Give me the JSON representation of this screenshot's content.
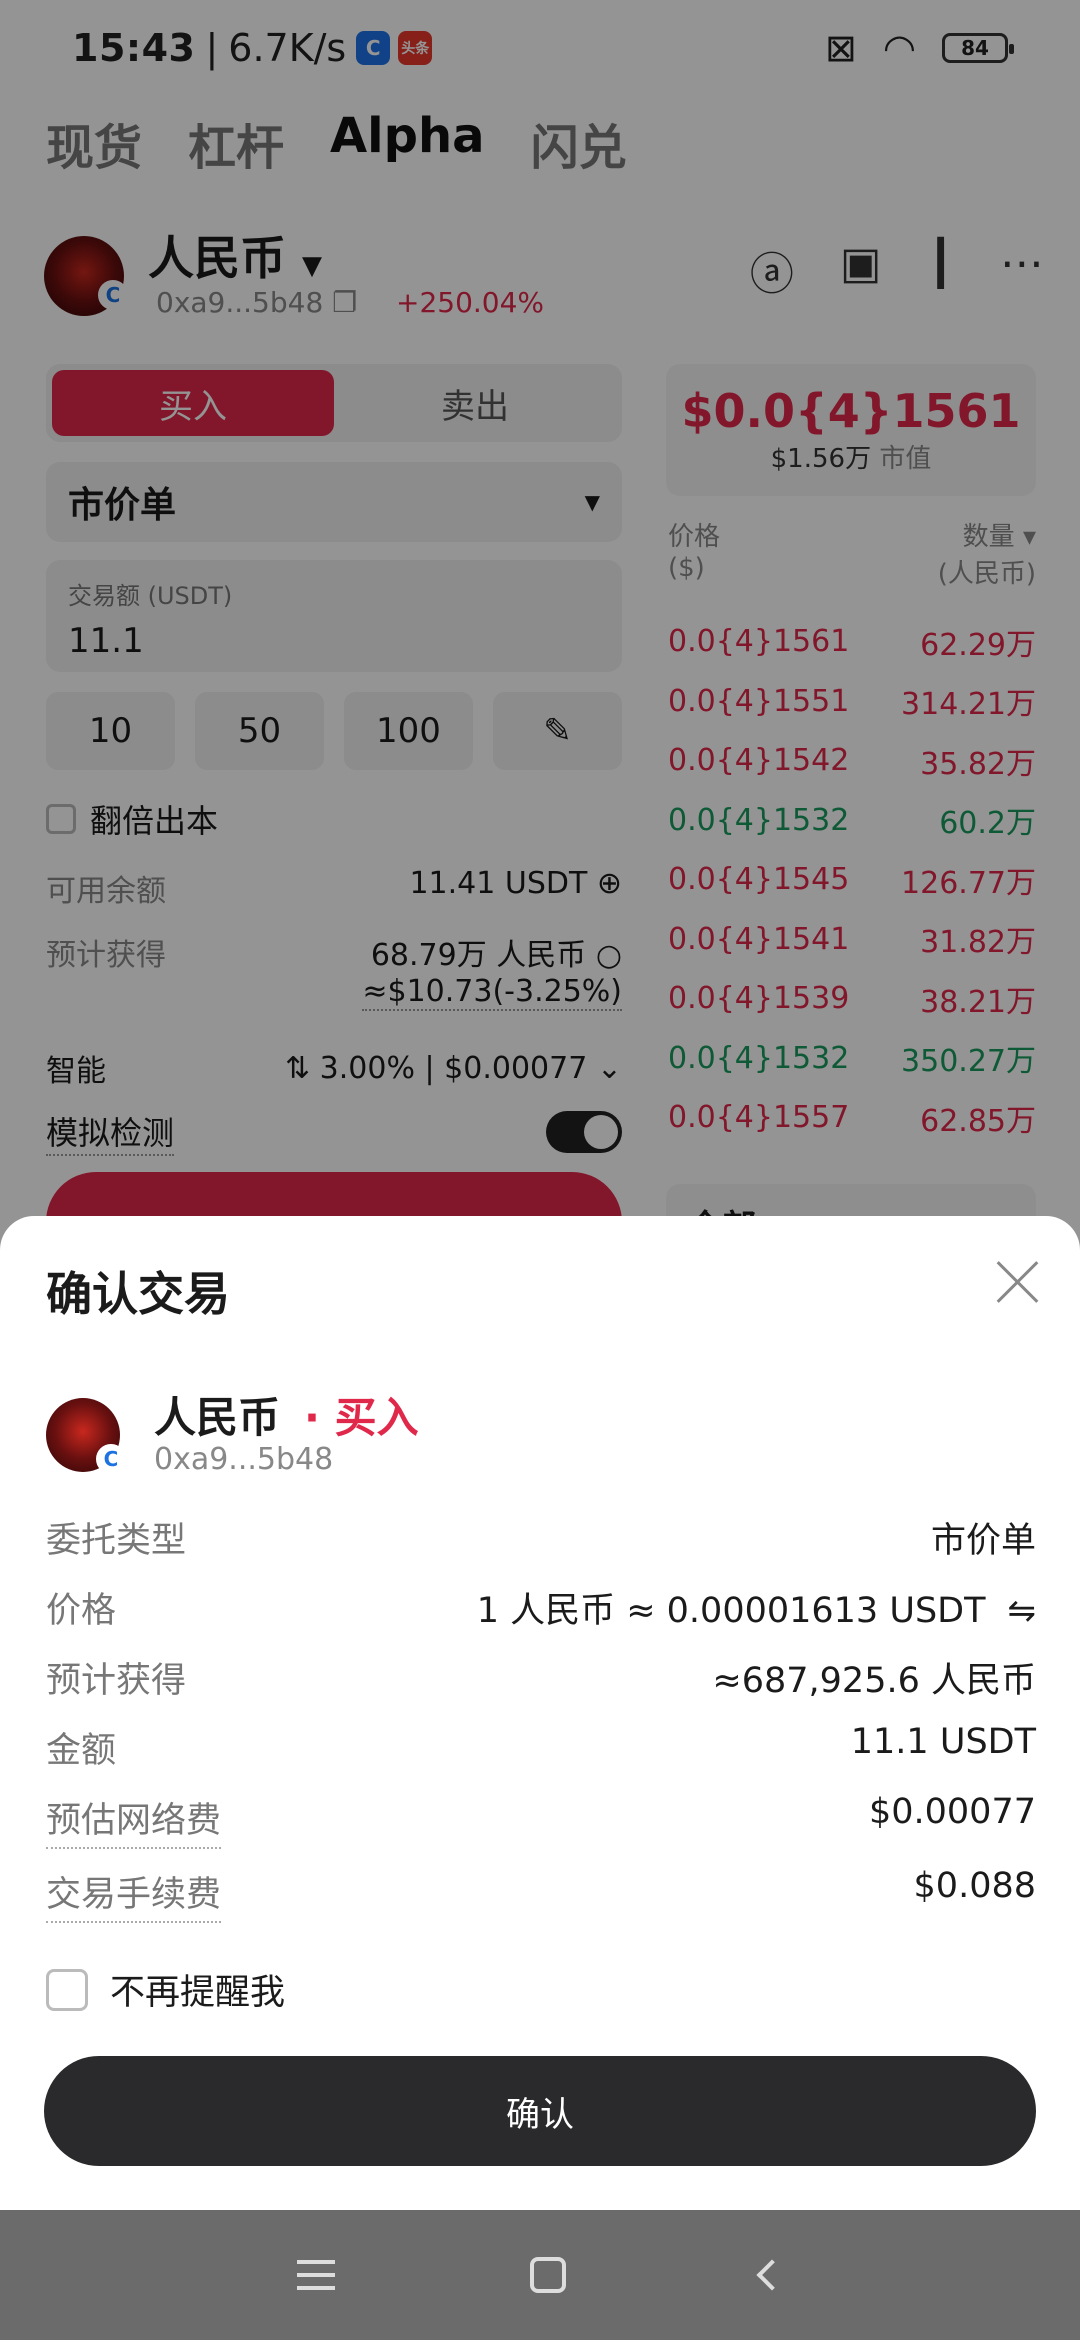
{
  "status": {
    "time": "15:43",
    "speed": "6.7K/s",
    "app2": "头条",
    "battery": "84"
  },
  "tabs": [
    "现货",
    "杠杆",
    "Alpha",
    "闪兑"
  ],
  "token": {
    "name": "人民币",
    "address": "0xa9...5b48",
    "change": "+250.04%"
  },
  "left": {
    "buy": "买入",
    "sell": "卖出",
    "order_type": "市价单",
    "amount_label": "交易额 (USDT)",
    "amount_value": "11.1",
    "chips": [
      "10",
      "50",
      "100"
    ],
    "double_label": "翻倍出本",
    "avail_label": "可用余额",
    "avail_value": "11.41 USDT",
    "est_label": "预计获得",
    "est_value": "68.79万 人民币",
    "est_usd": "≈$10.73(-3.25%)",
    "smart_label": "智能",
    "smart_value": "3.00% | $0.00077",
    "sim_label": "模拟检测"
  },
  "right": {
    "price": "$0.0{4}1561",
    "mcap": "$1.56万",
    "mcap_label": "市值",
    "col_price": "价格",
    "col_price_unit": "($)",
    "col_qty": "数量",
    "col_qty_unit": "(人民币)",
    "orderbook": [
      {
        "p": "0.0{4}1561",
        "q": "62.29万",
        "side": "red"
      },
      {
        "p": "0.0{4}1551",
        "q": "314.21万",
        "side": "red"
      },
      {
        "p": "0.0{4}1542",
        "q": "35.82万",
        "side": "red"
      },
      {
        "p": "0.0{4}1532",
        "q": "60.2万",
        "side": "green"
      },
      {
        "p": "0.0{4}1545",
        "q": "126.77万",
        "side": "red"
      },
      {
        "p": "0.0{4}1541",
        "q": "31.82万",
        "side": "red"
      },
      {
        "p": "0.0{4}1539",
        "q": "38.21万",
        "side": "red"
      },
      {
        "p": "0.0{4}1532",
        "q": "350.27万",
        "side": "green"
      },
      {
        "p": "0.0{4}1557",
        "q": "62.85万",
        "side": "red"
      }
    ],
    "all": "全部"
  },
  "sheet": {
    "title": "确认交易",
    "name": "人民币",
    "side": "· 买入",
    "address": "0xa9...5b48",
    "rows": [
      {
        "k": "委托类型",
        "v": "市价单"
      },
      {
        "k": "价格",
        "v": "1 人民币 ≈ 0.00001613 USDT"
      },
      {
        "k": "预计获得",
        "v": "≈687,925.6 人民币"
      },
      {
        "k": "金额",
        "v": "11.1 USDT"
      },
      {
        "k": "预估网络费",
        "v": "$0.00077"
      },
      {
        "k": "交易手续费",
        "v": "$0.088"
      }
    ],
    "remind": "不再提醒我",
    "confirm": "确认"
  },
  "colors": {
    "red": "#e0294a",
    "green": "#1a9b5e",
    "button": "#2a2a2c"
  }
}
